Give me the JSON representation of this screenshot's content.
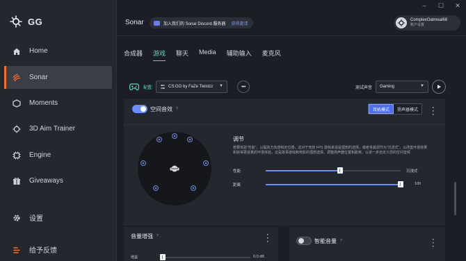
{
  "window": {
    "min": "–",
    "max": "☐",
    "close": "✕"
  },
  "brand": {
    "name": "GG"
  },
  "sidebar": {
    "items": [
      {
        "label": "Home",
        "icon": "home-icon"
      },
      {
        "label": "Sonar",
        "icon": "sonar-icon",
        "active": true
      },
      {
        "label": "Moments",
        "icon": "moments-icon"
      },
      {
        "label": "3D Aim Trainer",
        "icon": "aim-icon"
      },
      {
        "label": "Engine",
        "icon": "engine-icon"
      },
      {
        "label": "Giveaways",
        "icon": "gift-icon"
      }
    ],
    "settings": "设置",
    "feedback": "给予反馈"
  },
  "header": {
    "title": "Sonar",
    "discord_text": "加入我们的 Sonar Discord 服务器",
    "discord_join": "获得邀请",
    "user_name": "ComplexOatmeal68",
    "user_sub": "账户设置"
  },
  "tabs": [
    "合成器",
    "游戏",
    "聊天",
    "Media",
    "辅助输入",
    "麦克风"
  ],
  "config": {
    "label": "配置:",
    "selected": "CS:GO by FaZe Twistzz",
    "more": "•••",
    "test_label": "测试声音",
    "test_selected": "Gaming"
  },
  "spatial": {
    "title": "空间音效",
    "help": "?",
    "mode_headphone": "耳机模式",
    "mode_speaker": "扬声器模式",
    "adjust_title": "调节",
    "adjust_desc": "若要体验“性能”，以提高方向感和定位感，这对于竞技 FPS 游戏来说是理想的选择。或者将其调节为“沉浸式”，以改善环境效果和获得更逼真的环境体验，这是故事游戏和电影的理想选择。调整扬声器位置和距离，以进一步自定义您的空间音频",
    "slider1_left": "性能",
    "slider1_right": "沉浸式",
    "slider1_value": 0.55,
    "slider2_left": "距离",
    "slider2_value_text": "100",
    "slider2_value": 1.0
  },
  "volume_boost": {
    "title": "音量增强",
    "help": "?",
    "sub": "增益",
    "value": "0.0 dB"
  },
  "smart_volume": {
    "title": "智能音量",
    "help": "?"
  },
  "colors": {
    "accent": "#ff6b2c",
    "teal": "#5fd9b3",
    "blue": "#6a8cff"
  }
}
